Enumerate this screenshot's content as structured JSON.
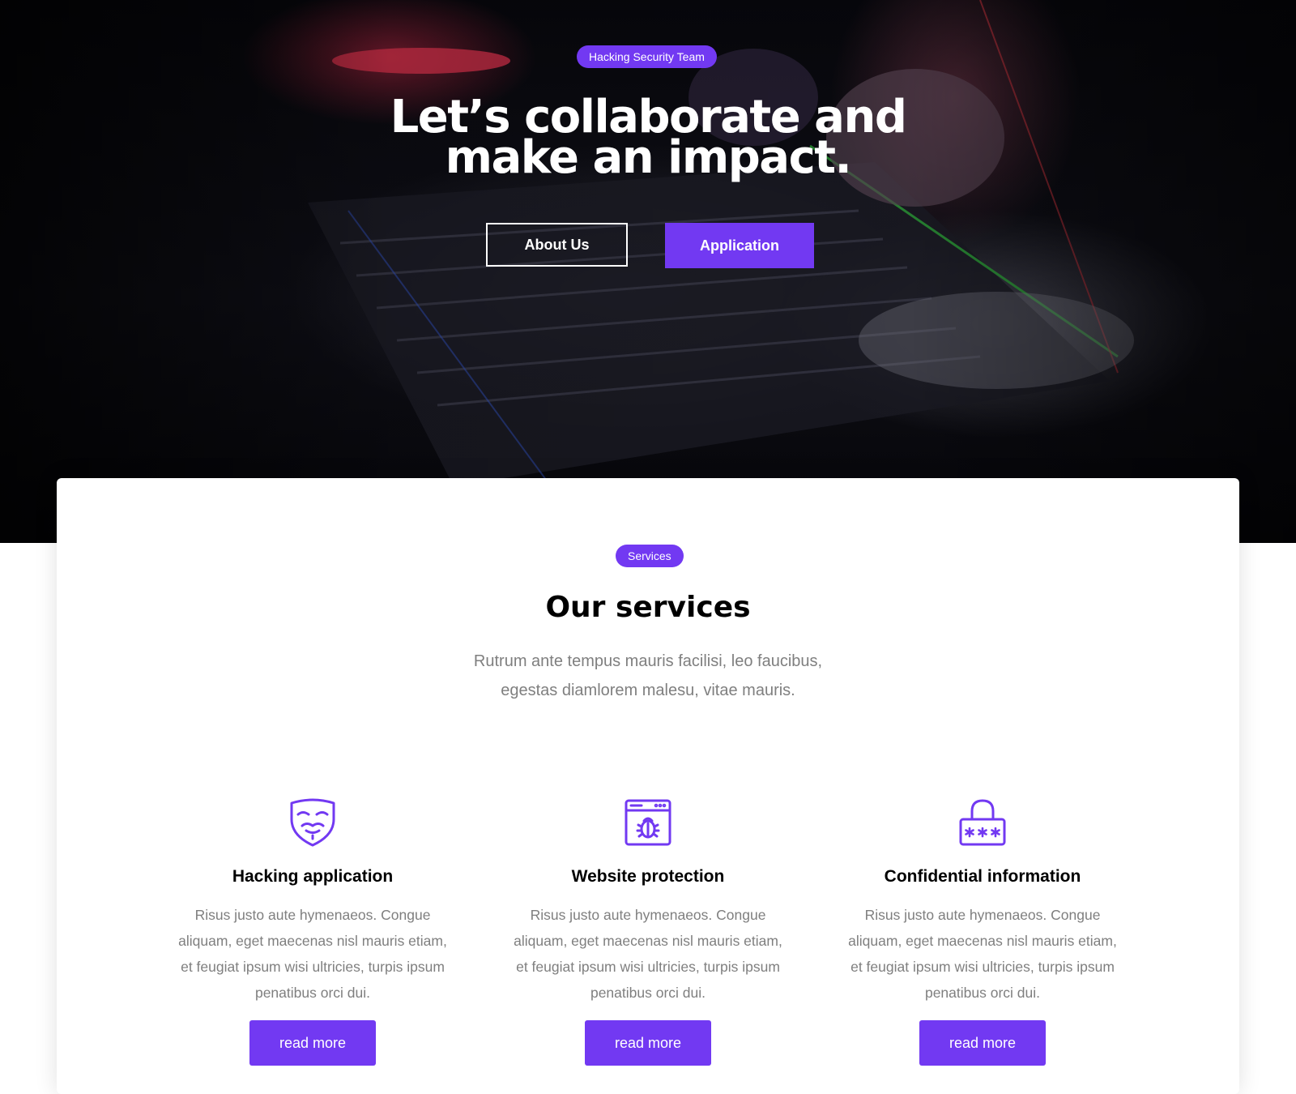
{
  "hero": {
    "tag": "Hacking Security Team",
    "title_line1": "Let’s collaborate and",
    "title_line2": "make an impact.",
    "about_button": "About Us",
    "application_button": "Application"
  },
  "services": {
    "tag": "Services",
    "title": "Our services",
    "subtitle_line1": "Rutrum ante tempus mauris facilisi, leo faucibus,",
    "subtitle_line2": "egestas diamlorem malesu, vitae mauris.",
    "items": [
      {
        "icon": "anonymous-mask-icon",
        "title": "Hacking application",
        "text": "Risus justo aute hymenaeos. Congue aliquam, eget maecenas nisl mauris etiam, et feugiat ipsum wisi ultricies, turpis ipsum penatibus orci dui.",
        "button": "read more"
      },
      {
        "icon": "browser-bug-icon",
        "title": "Website protection",
        "text": "Risus justo aute hymenaeos. Congue aliquam, eget maecenas nisl mauris etiam, et feugiat ipsum wisi ultricies, turpis ipsum penatibus orci dui.",
        "button": "read more"
      },
      {
        "icon": "password-lock-icon",
        "title": "Confidential information",
        "text": "Risus justo aute hymenaeos. Congue aliquam, eget maecenas nisl mauris etiam, et feugiat ipsum wisi ultricies, turpis ipsum penatibus orci dui.",
        "button": "read more"
      }
    ]
  },
  "colors": {
    "accent": "#7239f2",
    "text_dark": "#000000",
    "text_muted": "#7f7f7f",
    "white": "#ffffff"
  }
}
